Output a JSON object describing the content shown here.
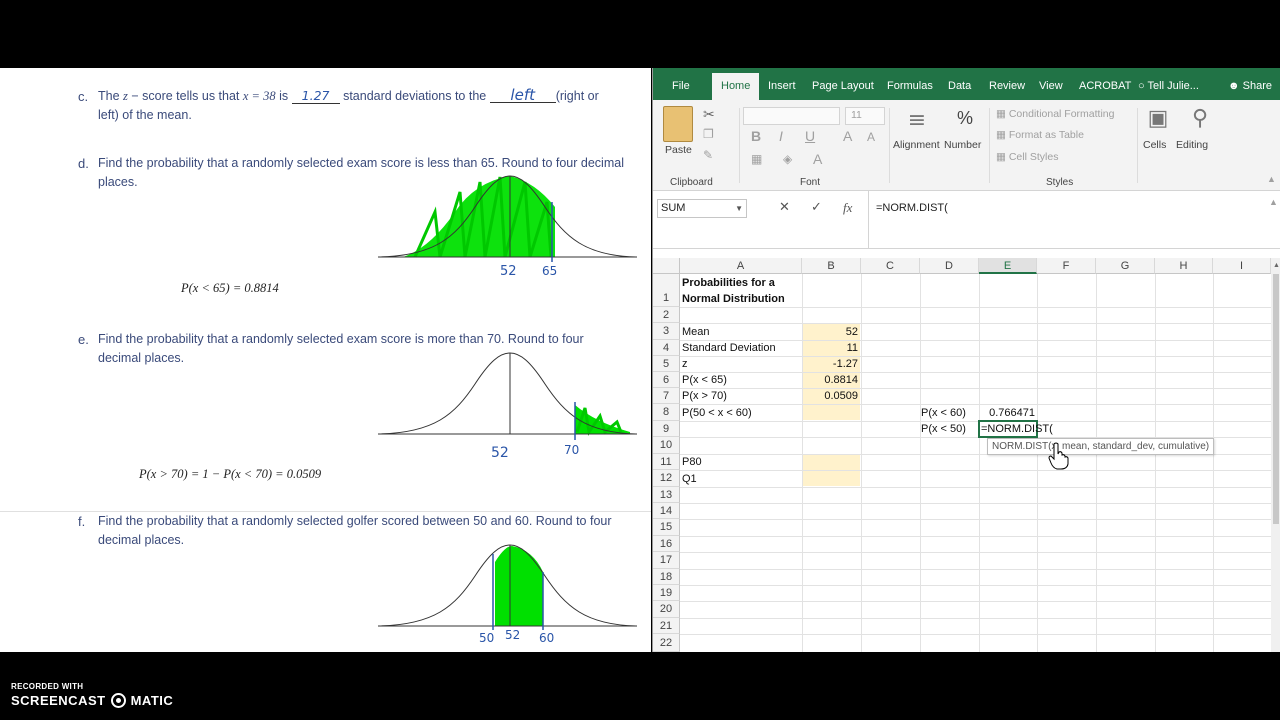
{
  "recorder": {
    "line1": "RECORDED WITH",
    "brand_left": "SCREENCAST",
    "brand_right": "MATIC"
  },
  "document": {
    "c": {
      "letter": "c.",
      "text_1": "The ",
      "z_var": "z",
      "text_2": " − score tells us that ",
      "x_eq": "x = 38",
      "text_3": " is ",
      "hand_value": "1.27",
      "text_4": " standard deviations to the ",
      "hand_direction": "left",
      "text_5": "(right or",
      "line2": "left) of the mean."
    },
    "d": {
      "letter": "d.",
      "line1": "Find the probability that a randomly selected exam score is less than 65. Round to four decimal",
      "line2": "places.",
      "answer": "P(x < 65) = 0.8814",
      "labels": [
        "52",
        "65"
      ]
    },
    "e": {
      "letter": "e.",
      "line1": "Find the probability that a randomly selected exam score is more than 70. Round to four",
      "line2": "decimal places.",
      "answer": "P(x > 70) = 1 − P(x < 70) = 0.0509",
      "labels": [
        "52",
        "70"
      ]
    },
    "f": {
      "letter": "f.",
      "line1": "Find the probability that a randomly selected golfer scored between 50 and 60. Round to four",
      "line2": "decimal places.",
      "labels": [
        "50",
        "52",
        "60"
      ]
    }
  },
  "excel": {
    "tabs": [
      "File",
      "Home",
      "Insert",
      "Page Layout",
      "Formulas",
      "Data",
      "Review",
      "View",
      "ACROBAT",
      "Tell Julie...",
      "Share"
    ],
    "active_tab": "Home",
    "ribbon": {
      "paste": "Paste",
      "clipboard": "Clipboard",
      "font_size": "11",
      "font_group": "Font",
      "alignment": "Alignment",
      "number": "Number",
      "number_symbol": "%",
      "conditional_formatting": "Conditional Formatting",
      "format_as_table": "Format as Table",
      "cell_styles": "Cell Styles",
      "styles_group": "Styles",
      "cells": "Cells",
      "editing": "Editing"
    },
    "namebox": "SUM",
    "formula": "=NORM.DIST(",
    "columns": [
      "A",
      "B",
      "C",
      "D",
      "E",
      "F",
      "G",
      "H",
      "I"
    ],
    "selected_column": "E",
    "rows": [
      "1",
      "2",
      "3",
      "4",
      "5",
      "6",
      "7",
      "8",
      "9",
      "10",
      "11",
      "12",
      "13",
      "14",
      "15",
      "16",
      "17",
      "18",
      "19",
      "20",
      "21",
      "22"
    ],
    "cells": {
      "A1a": "Probabilities for a",
      "A1b": "Normal Distribution",
      "A3": "Mean",
      "B3": "52",
      "A4": "Standard Deviation",
      "B4": "11",
      "A5": "z",
      "B5": "-1.27",
      "A6": "P(x < 65)",
      "B6": "0.8814",
      "A7": "P(x > 70)",
      "B7": "0.0509",
      "A8": "P(50 < x < 60)",
      "D8": "P(x < 60)",
      "E8": "0.766471",
      "D9": "P(x < 50)",
      "E9": "=NORM.DIST(",
      "A11": "P80",
      "A12": "Q1"
    },
    "tooltip": "NORM.DIST(x, mean, standard_dev, cumulative)",
    "colors": {
      "green": "#217346",
      "yellow": "#fff2cc",
      "highlight": "#00e600"
    }
  }
}
